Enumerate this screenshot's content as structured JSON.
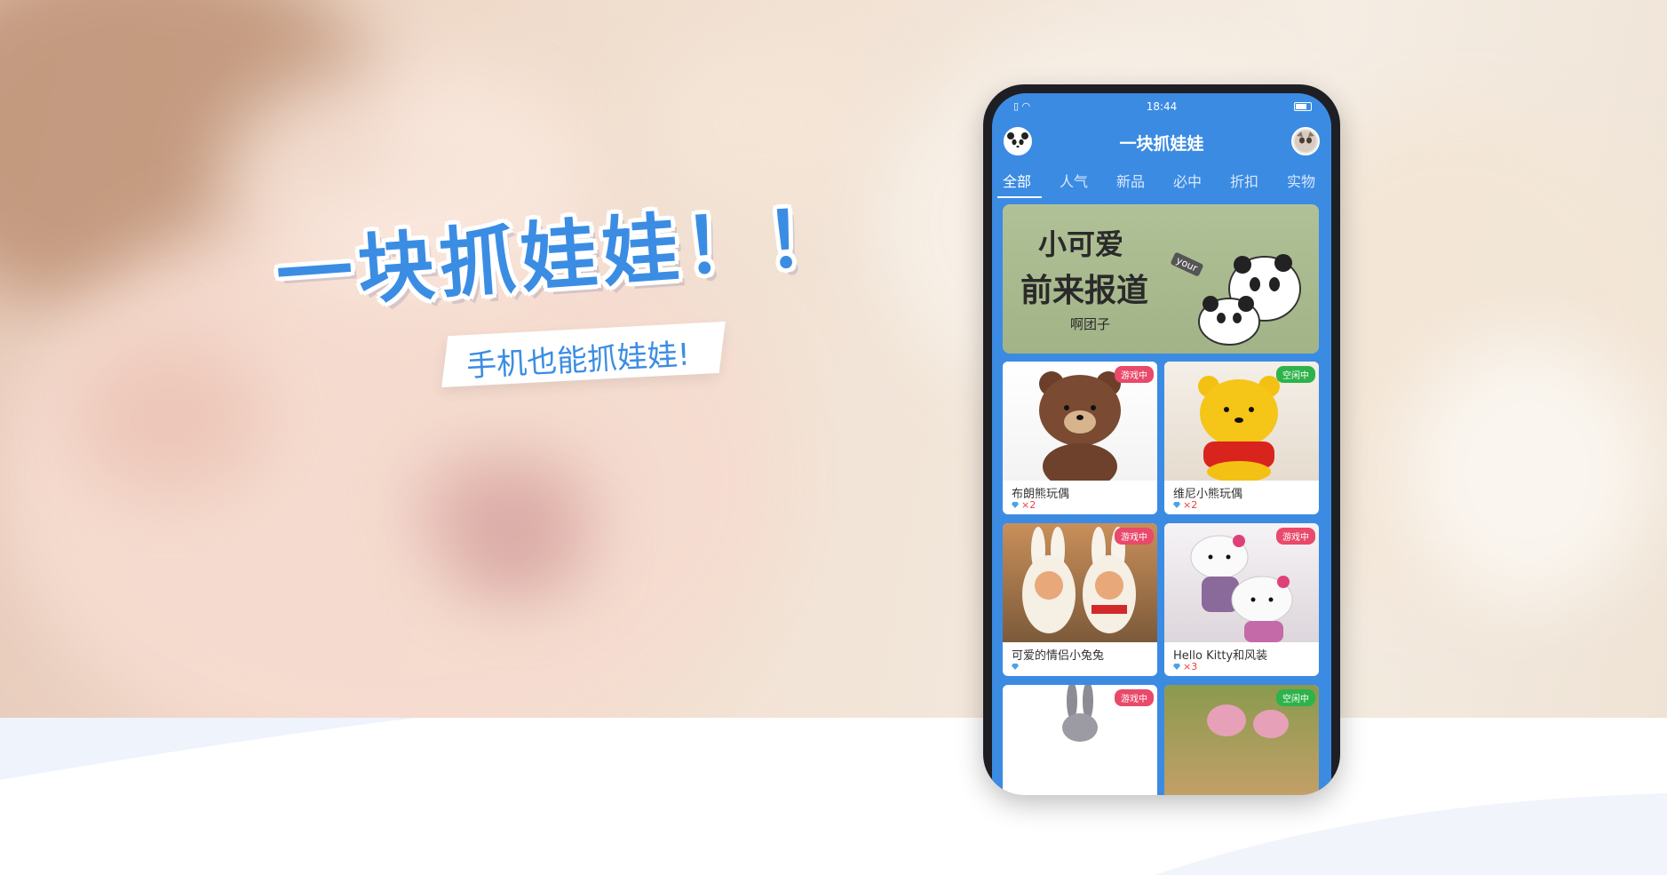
{
  "hero": {
    "headline": "一块抓娃娃！！",
    "subline": "手机也能抓娃娃!"
  },
  "phone": {
    "status": {
      "time": "18:44",
      "signal": "▯ ◠"
    },
    "app_title": "一块抓娃娃",
    "tabs": [
      {
        "label": "全部",
        "active": true
      },
      {
        "label": "人气"
      },
      {
        "label": "新品"
      },
      {
        "label": "必中"
      },
      {
        "label": "折扣"
      },
      {
        "label": "实物"
      }
    ],
    "banner": {
      "line1": "小可爱",
      "line2": "前来报道",
      "line3": "啊团子",
      "tag": "your"
    },
    "products": [
      {
        "name": "布朗熊玩偶",
        "price": "×2",
        "status": "游戏中"
      },
      {
        "name": "维尼小熊玩偶",
        "price": "×2",
        "status": "空闲中"
      },
      {
        "name": "可爱的情侣小兔兔",
        "price": "",
        "status": "游戏中"
      },
      {
        "name": "Hello Kitty和风装",
        "price": "×3",
        "status": "游戏中"
      },
      {
        "name": "",
        "price": "",
        "status": "游戏中"
      },
      {
        "name": "",
        "price": "",
        "status": "空闲中"
      }
    ]
  },
  "colors": {
    "brand_blue": "#3b8be3",
    "badge_playing": "#e9496a",
    "badge_idle": "#2db34a",
    "price_red": "#e8413f"
  }
}
